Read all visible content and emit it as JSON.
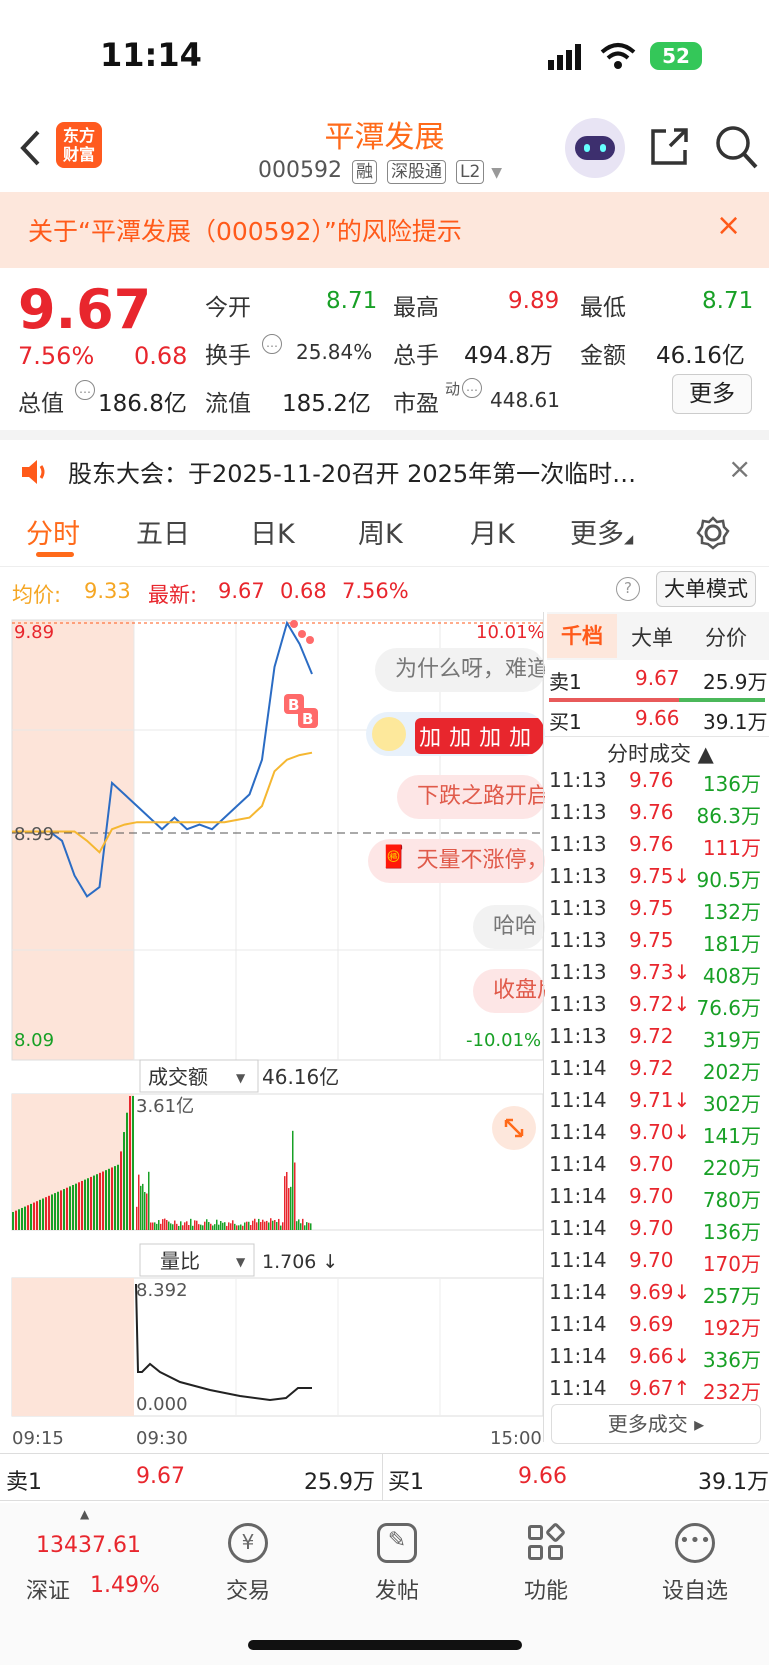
{
  "status_bar": {
    "time": "11:14",
    "battery": "52"
  },
  "header": {
    "logo_text_line1": "东方",
    "logo_text_line2": "财富",
    "stock_name": "平潭发展",
    "stock_code": "000592",
    "tags": [
      "融",
      "深股通",
      "L2"
    ]
  },
  "risk_notice": {
    "text": "关于“平潭发展（000592）”的风险提示",
    "close": "×"
  },
  "quote": {
    "price": "9.67",
    "change_pct": "7.56%",
    "change": "0.68",
    "open_label": "今开",
    "open": "8.71",
    "high_label": "最高",
    "high": "9.89",
    "low_label": "最低",
    "low": "8.71",
    "turnover_label": "换手",
    "turnover": "25.84%",
    "volume_label": "总手",
    "volume": "494.8万",
    "amount_label": "金额",
    "amount": "46.16亿",
    "mktcap_label": "总值",
    "mktcap": "186.8亿",
    "float_label": "流值",
    "float": "185.2亿",
    "pe_label": "市盈",
    "pe_sup": "动",
    "pe": "448.61",
    "more_button": "更多"
  },
  "notice": {
    "text": "股东大会：于2025-11-20召开 2025年第一次临时…",
    "close": "×"
  },
  "tabs": {
    "items": [
      "分时",
      "五日",
      "日K",
      "周K",
      "月K",
      "更多"
    ]
  },
  "info_line": {
    "avg_label": "均价:",
    "avg": "9.33",
    "latest_label": "最新:",
    "latest": "9.67",
    "change": "0.68",
    "change_pct": "7.56%",
    "big_order_button": "大单模式"
  },
  "chart": {
    "y_high": "9.89",
    "y_mid": "8.99",
    "y_low": "8.09",
    "pct_high": "10.01%",
    "pct_low": "-10.01%",
    "amount_selector": "成交额",
    "amount_total": "46.16亿",
    "amount_max": "3.61亿",
    "ratio_selector": "量比",
    "ratio_value": "1.706 ↓",
    "ratio_max": "8.392",
    "ratio_min": "0.000",
    "time_start": "09:15",
    "time_open": "09:30",
    "time_end": "15:00",
    "marker_b": "B",
    "bubbles": [
      "为什么呀，难道",
      "加加加加",
      "下跌之路开启",
      "天量不涨停，",
      "哈哈",
      "收盘后"
    ]
  },
  "chart_data": {
    "type": "line",
    "title": "",
    "xlabel": "",
    "ylabel": "",
    "ylim": [
      8.09,
      9.89
    ],
    "x_ticks": [
      "09:15",
      "09:30",
      "15:00"
    ],
    "series": [
      {
        "values": [
          8.99,
          8.99,
          8.99,
          8.99,
          8.95,
          8.8,
          8.71,
          8.75,
          9.2,
          9.15,
          9.1,
          9.05,
          9.0,
          9.05,
          9.0,
          9.02,
          9.0,
          9.05,
          9.1,
          9.15,
          9.3,
          9.7,
          9.89,
          9.8,
          9.67
        ]
      },
      {
        "values": [
          8.99,
          8.99,
          8.99,
          8.99,
          8.99,
          8.99,
          8.95,
          8.9,
          9.0,
          9.02,
          9.03,
          9.03,
          9.03,
          9.03,
          9.03,
          9.03,
          9.03,
          9.03,
          9.04,
          9.05,
          9.1,
          9.25,
          9.3,
          9.32,
          9.33
        ]
      }
    ]
  },
  "right_panel": {
    "tabs": [
      "千档",
      "大单",
      "分价"
    ],
    "ask1_label": "卖1",
    "ask1_price": "9.67",
    "ask1_vol": "25.9万",
    "bid1_label": "买1",
    "bid1_price": "9.66",
    "bid1_vol": "39.1万",
    "trades_title": "分时成交 ▲",
    "trades": [
      {
        "t": "11:13",
        "p": "9.76",
        "v": "136万"
      },
      {
        "t": "11:13",
        "p": "9.76",
        "v": "86.3万"
      },
      {
        "t": "11:13",
        "p": "9.76",
        "v": "111万"
      },
      {
        "t": "11:13",
        "p": "9.75↓",
        "v": "90.5万"
      },
      {
        "t": "11:13",
        "p": "9.75",
        "v": "132万"
      },
      {
        "t": "11:13",
        "p": "9.75",
        "v": "181万"
      },
      {
        "t": "11:13",
        "p": "9.73↓",
        "v": "408万"
      },
      {
        "t": "11:13",
        "p": "9.72↓",
        "v": "76.6万"
      },
      {
        "t": "11:13",
        "p": "9.72",
        "v": "319万"
      },
      {
        "t": "11:14",
        "p": "9.72",
        "v": "202万"
      },
      {
        "t": "11:14",
        "p": "9.71↓",
        "v": "302万"
      },
      {
        "t": "11:14",
        "p": "9.70↓",
        "v": "141万"
      },
      {
        "t": "11:14",
        "p": "9.70",
        "v": "220万"
      },
      {
        "t": "11:14",
        "p": "9.70",
        "v": "780万"
      },
      {
        "t": "11:14",
        "p": "9.70",
        "v": "136万"
      },
      {
        "t": "11:14",
        "p": "9.70",
        "v": "170万"
      },
      {
        "t": "11:14",
        "p": "9.69↓",
        "v": "257万"
      },
      {
        "t": "11:14",
        "p": "9.69",
        "v": "192万"
      },
      {
        "t": "11:14",
        "p": "9.66↓",
        "v": "336万"
      },
      {
        "t": "11:14",
        "p": "9.67↑",
        "v": "232万"
      }
    ],
    "more_trades": "更多成交 ▸"
  },
  "bottom_book": {
    "sell1_label": "卖1",
    "sell1_price": "9.67",
    "sell1_vol": "25.9万",
    "buy1_label": "买1",
    "buy1_price": "9.66",
    "buy1_vol": "39.1万"
  },
  "bottom_nav": {
    "index_value": "13437.61",
    "index_name": "深证",
    "index_change": "1.49%",
    "items": [
      "交易",
      "发帖",
      "功能",
      "设自选"
    ]
  },
  "colors": {
    "up": "#e8262d",
    "down": "#18a026",
    "accent": "#ff6a1a"
  }
}
